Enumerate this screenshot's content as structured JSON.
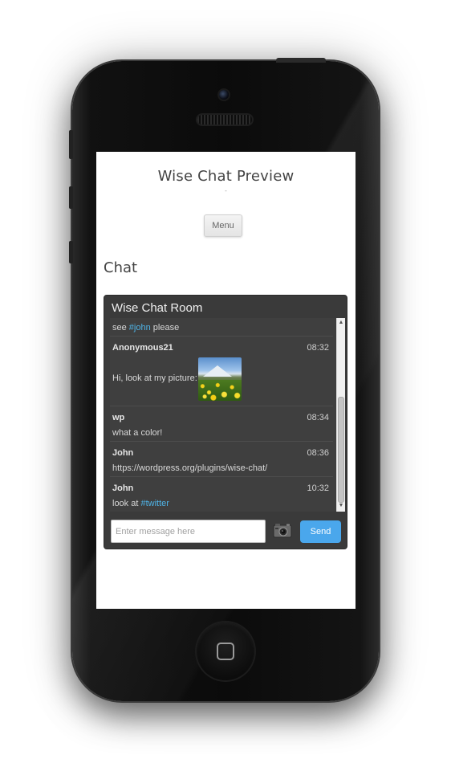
{
  "site": {
    "title": "Wise Chat Preview",
    "tagline": "-",
    "menu_label": "Menu",
    "page_heading": "Chat"
  },
  "chat": {
    "room_title": "Wise Chat Room",
    "messages": [
      {
        "user": "",
        "time": "",
        "text_prefix": "see ",
        "link": "#john",
        "text_suffix": " please"
      },
      {
        "user": "Anonymous21",
        "time": "08:32",
        "text_prefix": "Hi, look at my picture:",
        "link": "",
        "text_suffix": "",
        "has_image": true
      },
      {
        "user": "wp",
        "time": "08:34",
        "text_prefix": "what a color!",
        "link": "",
        "text_suffix": ""
      },
      {
        "user": "John",
        "time": "08:36",
        "text_prefix": "",
        "link": "https://wordpress.org/plugins/wise-chat/",
        "text_suffix": ""
      },
      {
        "user": "John",
        "time": "10:32",
        "text_prefix": "look at ",
        "link": "#twitter",
        "text_suffix": ""
      }
    ],
    "input_placeholder": "Enter message here",
    "input_value": "",
    "send_label": "Send",
    "image_button_icon": "camera-icon"
  },
  "colors": {
    "link": "#4fb3e6",
    "send_button": "#4aa7ec",
    "chat_background": "#3a3a3a"
  }
}
